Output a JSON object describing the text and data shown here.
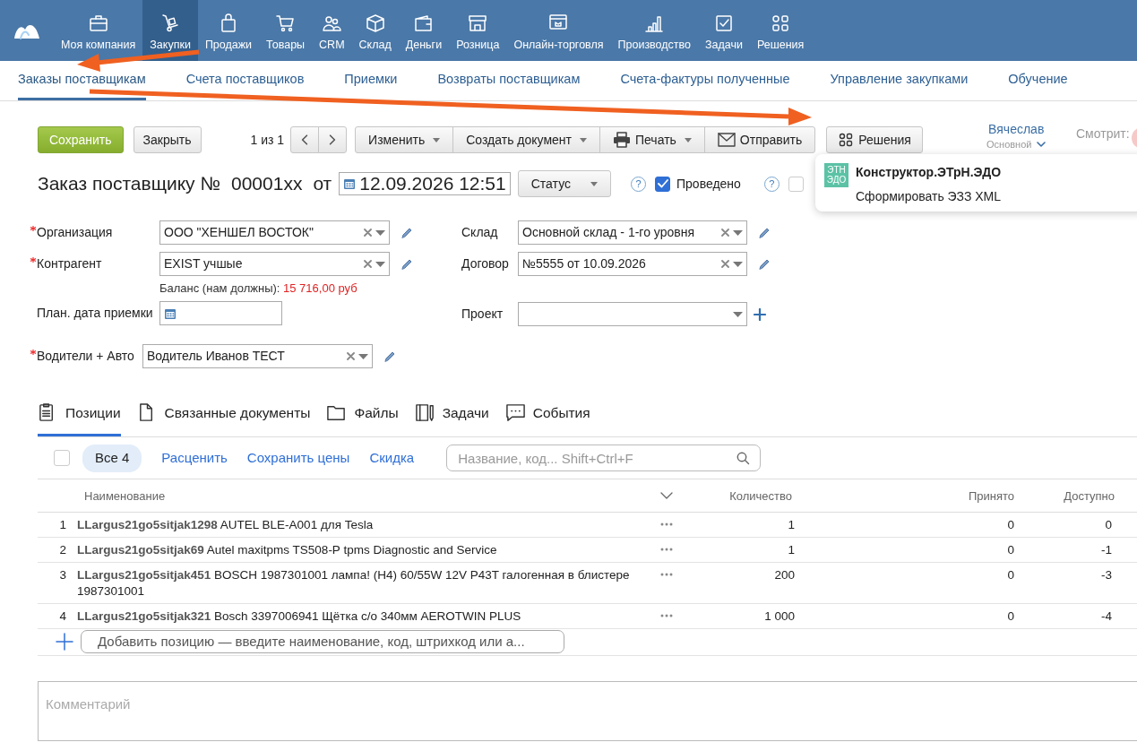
{
  "top_nav": [
    {
      "label": "Моя компания",
      "selected": false
    },
    {
      "label": "Закупки",
      "selected": true
    },
    {
      "label": "Продажи",
      "selected": false
    },
    {
      "label": "Товары",
      "selected": false
    },
    {
      "label": "CRM",
      "selected": false
    },
    {
      "label": "Склад",
      "selected": false
    },
    {
      "label": "Деньги",
      "selected": false
    },
    {
      "label": "Розница",
      "selected": false
    },
    {
      "label": "Онлайн-торговля",
      "selected": false
    },
    {
      "label": "Производство",
      "selected": false
    },
    {
      "label": "Задачи",
      "selected": false
    },
    {
      "label": "Решения",
      "selected": false
    }
  ],
  "sub_nav": [
    {
      "label": "Заказы поставщикам",
      "selected": true
    },
    {
      "label": "Счета поставщиков",
      "selected": false
    },
    {
      "label": "Приемки",
      "selected": false
    },
    {
      "label": "Возвраты поставщикам",
      "selected": false
    },
    {
      "label": "Счета-фактуры полученные",
      "selected": false
    },
    {
      "label": "Управление закупками",
      "selected": false
    },
    {
      "label": "Обучение",
      "selected": false
    }
  ],
  "toolbar": {
    "save": "Сохранить",
    "close": "Закрыть",
    "pager": "1 из 1",
    "menus": [
      "Изменить",
      "Создать документ",
      "Печать",
      "Отправить"
    ],
    "solutions": "Решения"
  },
  "user": {
    "name": "Вячеслав",
    "role": "Основной",
    "viewers_label": "Смотрит:"
  },
  "document": {
    "title": "Заказ поставщику №",
    "number": "00001xx",
    "date_prefix": "от",
    "date": "12.09.2026 12:51",
    "status": "Статус",
    "posted": {
      "help": "?",
      "label": "Проведено",
      "checked": true
    },
    "second_flag": {
      "help": "?",
      "checked": false
    }
  },
  "solutions_popup": {
    "logo_lines": [
      "ЭТН",
      "ЭДО"
    ],
    "title": "Конструктор.ЭТрН.ЭДО",
    "item": "Сформировать ЭЗЗ XML"
  },
  "fields_left": [
    {
      "label": "Организация",
      "required": true,
      "kind": "editable_select",
      "value": "ООО \"ХЕНШЕЛ ВОСТОК\""
    },
    {
      "label": "Контрагент",
      "required": true,
      "kind": "editable_select",
      "value": "EXIST учшые",
      "balance_label": "Баланс (нам должны):",
      "balance_amount": "15 716,00 руб"
    },
    {
      "label": "План. дата приемки",
      "required": false,
      "kind": "date"
    }
  ],
  "fields_right": [
    {
      "label": "Склад",
      "required": false,
      "kind": "editable_select",
      "value": "Основной склад - 1-го уровня"
    },
    {
      "label": "Договор",
      "required": false,
      "kind": "editable_select",
      "value": "№5555 от 10.09.2026"
    },
    {
      "label": "Проект",
      "required": false,
      "kind": "addable_select"
    }
  ],
  "drivers": {
    "label": "Водители + Авто",
    "required": true,
    "kind": "editable_select",
    "value": "Водитель Иванов ТЕСТ"
  },
  "tabs": [
    {
      "label": "Позиции",
      "selected": true
    },
    {
      "label": "Связанные документы",
      "selected": false
    },
    {
      "label": "Файлы",
      "selected": false
    },
    {
      "label": "Задачи",
      "selected": false
    },
    {
      "label": "События",
      "selected": false
    }
  ],
  "positions_toolbar": {
    "select_all": {
      "checked": false
    },
    "all": "Все 4",
    "links": [
      "Расценить",
      "Сохранить цены",
      "Скидка"
    ],
    "search_placeholder": "Название, код... Shift+Ctrl+F"
  },
  "table": {
    "columns": [
      "Наименование",
      "Количество",
      "Принято",
      "Доступно"
    ],
    "rows": [
      {
        "num": "1",
        "name": "**LLargus21go5sitjak1298** AUTEL BLE-A001 для Tesla",
        "quantity": "1",
        "accepted": "0",
        "available": "0"
      },
      {
        "num": "2",
        "name": "**LLargus21go5sitjak69** Autel maxitpms TS508-P tpms Diagnostic and Service",
        "quantity": "1",
        "accepted": "0",
        "available": "-1"
      },
      {
        "num": "3",
        "name": "**LLargus21go5sitjak451** BOSCH 1987301001 лампа! (H4) 60/55W 12V P43T галогенная в блистере 1987301001",
        "quantity": "200",
        "accepted": "0",
        "available": "-3"
      },
      {
        "num": "4",
        "name": "**LLargus21go5sitjak321** Bosch 3397006941 Щётка с/о 340мм AEROTWIN PLUS",
        "quantity": "1 000",
        "accepted": "0",
        "available": "-4"
      }
    ]
  },
  "add_position_placeholder": "Добавить позицию — введите наименование, код, штрихкод или а...",
  "comment_placeholder": "Комментарий"
}
